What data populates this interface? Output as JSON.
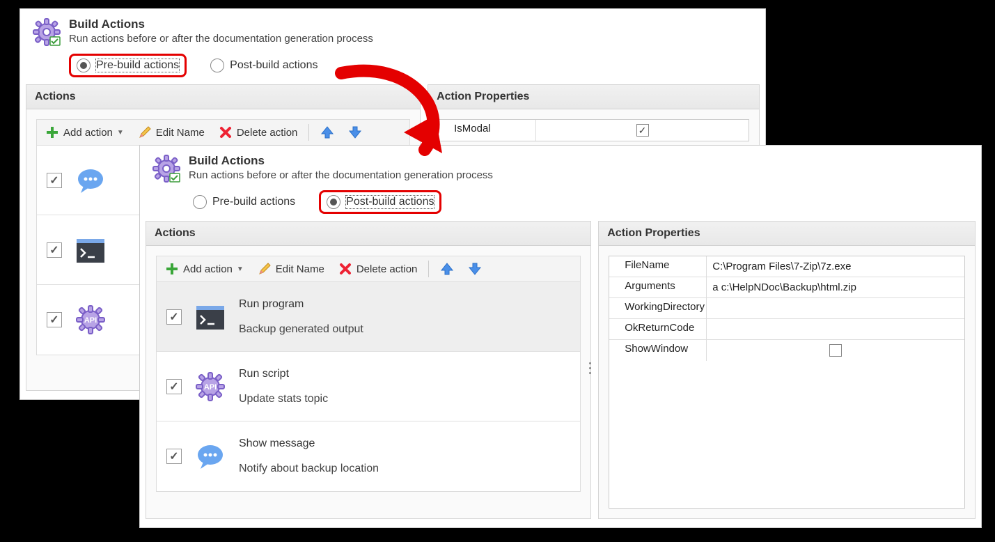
{
  "header": {
    "title": "Build Actions",
    "subtitle": "Run actions before or after the documentation generation process"
  },
  "radios": {
    "pre": "Pre-build actions",
    "post": "Post-build actions"
  },
  "sections": {
    "actions": "Actions",
    "props": "Action Properties"
  },
  "toolbar": {
    "add": "Add action",
    "edit": "Edit Name",
    "del": "Delete action"
  },
  "front_actions": [
    {
      "title": "Run program",
      "sub": "Backup generated output",
      "icon": "terminal"
    },
    {
      "title": "Run script",
      "sub": "Update stats topic",
      "icon": "api"
    },
    {
      "title": "Show message",
      "sub": "Notify about backup location",
      "icon": "bubble"
    }
  ],
  "back_props": [
    {
      "key": "IsModal",
      "val": "",
      "chk": true
    }
  ],
  "front_props": [
    {
      "key": "FileName",
      "val": "C:\\Program Files\\7-Zip\\7z.exe"
    },
    {
      "key": "Arguments",
      "val": "a c:\\HelpNDoc\\Backup\\html.zip"
    },
    {
      "key": "WorkingDirectory",
      "val": ""
    },
    {
      "key": "OkReturnCode",
      "val": ""
    },
    {
      "key": "ShowWindow",
      "val": "",
      "chk": false
    }
  ]
}
